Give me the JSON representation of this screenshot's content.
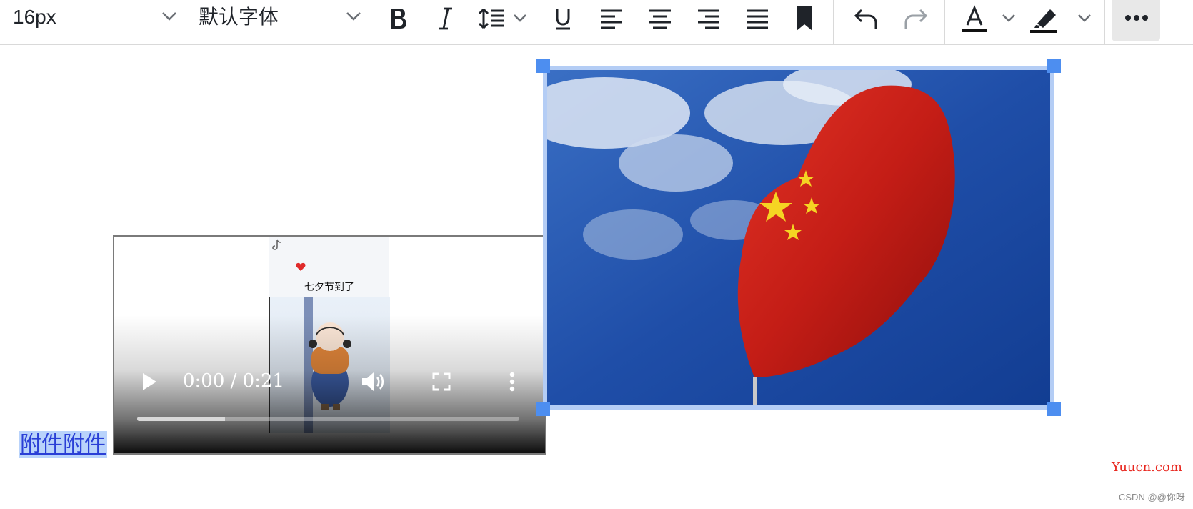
{
  "toolbar": {
    "font_size": "16px",
    "font_family": "默认字体"
  },
  "video": {
    "time": "0:00 / 0:21",
    "progress": 0.23,
    "caption": "七夕节到了"
  },
  "content": {
    "link_text": "附件附件"
  },
  "watermark": {
    "site": "Yuucn.com",
    "credit": "CSDN @@你呀"
  },
  "colors": {
    "accent": "#4d8ef0",
    "selection": "#b4cdf5",
    "link": "#2a3fd6",
    "watermark": "#e8261e"
  }
}
